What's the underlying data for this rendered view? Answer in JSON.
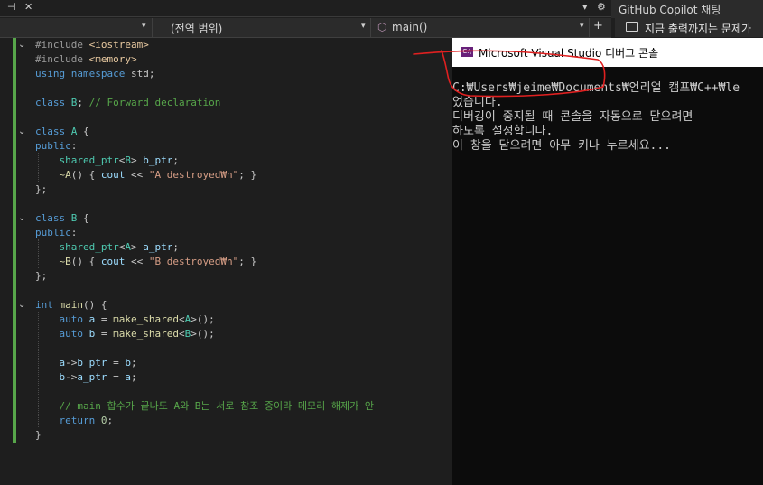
{
  "toolbar": {
    "pin_glyph": "⊣",
    "close_glyph": "✕",
    "dropdown_glyph": "▾",
    "gear_glyph": "⚙"
  },
  "navigation": {
    "project_value": "",
    "scope_label": "(전역 범위)",
    "member_label": "main()",
    "split_glyph": "+"
  },
  "copilot": {
    "panel_title": "GitHub Copilot 채팅",
    "prompt_text": "지금 출력까지는 문제가"
  },
  "editor": {
    "lines": [
      {
        "parts": [
          [
            "pp",
            "#include "
          ],
          [
            "inc",
            "<iostream>"
          ]
        ]
      },
      {
        "parts": [
          [
            "pp",
            "#include "
          ],
          [
            "inc",
            "<memory>"
          ]
        ]
      },
      {
        "parts": [
          [
            "kw",
            "using namespace "
          ],
          [
            "pl",
            "std;"
          ]
        ]
      },
      {
        "parts": []
      },
      {
        "parts": [
          [
            "kw",
            "class "
          ],
          [
            "ty",
            "B"
          ],
          [
            "pl",
            "; "
          ],
          [
            "cm",
            "// Forward declaration"
          ]
        ]
      },
      {
        "parts": []
      },
      {
        "parts": [
          [
            "kw",
            "class "
          ],
          [
            "ty",
            "A"
          ],
          [
            "pl",
            " {"
          ]
        ]
      },
      {
        "parts": [
          [
            "kw",
            "public"
          ],
          [
            "pl",
            ":"
          ]
        ]
      },
      {
        "parts": [
          [
            "pl",
            "    "
          ],
          [
            "ty",
            "shared_ptr"
          ],
          [
            "pl",
            "<"
          ],
          [
            "ty",
            "B"
          ],
          [
            "pl",
            "> "
          ],
          [
            "ptr",
            "b_ptr"
          ],
          [
            "pl",
            ";"
          ]
        ]
      },
      {
        "parts": [
          [
            "pl",
            "    "
          ],
          [
            "fn",
            "~A"
          ],
          [
            "pl",
            "() { "
          ],
          [
            "ptr",
            "cout"
          ],
          [
            "pl",
            " << "
          ],
          [
            "st",
            "\"A destroyed₩n\""
          ],
          [
            "pl",
            "; }"
          ]
        ]
      },
      {
        "parts": [
          [
            "pl",
            "};"
          ]
        ]
      },
      {
        "parts": []
      },
      {
        "parts": [
          [
            "kw",
            "class "
          ],
          [
            "ty",
            "B"
          ],
          [
            "pl",
            " {"
          ]
        ]
      },
      {
        "parts": [
          [
            "kw",
            "public"
          ],
          [
            "pl",
            ":"
          ]
        ]
      },
      {
        "parts": [
          [
            "pl",
            "    "
          ],
          [
            "ty",
            "shared_ptr"
          ],
          [
            "pl",
            "<"
          ],
          [
            "ty",
            "A"
          ],
          [
            "pl",
            "> "
          ],
          [
            "ptr",
            "a_ptr"
          ],
          [
            "pl",
            ";"
          ]
        ]
      },
      {
        "parts": [
          [
            "pl",
            "    "
          ],
          [
            "fn",
            "~B"
          ],
          [
            "pl",
            "() { "
          ],
          [
            "ptr",
            "cout"
          ],
          [
            "pl",
            " << "
          ],
          [
            "st",
            "\"B destroyed₩n\""
          ],
          [
            "pl",
            "; }"
          ]
        ]
      },
      {
        "parts": [
          [
            "pl",
            "};"
          ]
        ]
      },
      {
        "parts": []
      },
      {
        "parts": [
          [
            "kw",
            "int "
          ],
          [
            "fn",
            "main"
          ],
          [
            "pl",
            "() {"
          ]
        ]
      },
      {
        "parts": [
          [
            "pl",
            "    "
          ],
          [
            "kw",
            "auto "
          ],
          [
            "ptr",
            "a"
          ],
          [
            "pl",
            " = "
          ],
          [
            "fn",
            "make_shared"
          ],
          [
            "pl",
            "<"
          ],
          [
            "ty",
            "A"
          ],
          [
            "pl",
            ">();"
          ]
        ]
      },
      {
        "parts": [
          [
            "pl",
            "    "
          ],
          [
            "kw",
            "auto "
          ],
          [
            "ptr",
            "b"
          ],
          [
            "pl",
            " = "
          ],
          [
            "fn",
            "make_shared"
          ],
          [
            "pl",
            "<"
          ],
          [
            "ty",
            "B"
          ],
          [
            "pl",
            ">();"
          ]
        ]
      },
      {
        "parts": []
      },
      {
        "parts": [
          [
            "pl",
            "    "
          ],
          [
            "ptr",
            "a"
          ],
          [
            "pl",
            "->"
          ],
          [
            "ptr",
            "b_ptr"
          ],
          [
            "pl",
            " = "
          ],
          [
            "ptr",
            "b"
          ],
          [
            "pl",
            ";"
          ]
        ]
      },
      {
        "parts": [
          [
            "pl",
            "    "
          ],
          [
            "ptr",
            "b"
          ],
          [
            "pl",
            "->"
          ],
          [
            "ptr",
            "a_ptr"
          ],
          [
            "pl",
            " = "
          ],
          [
            "ptr",
            "a"
          ],
          [
            "pl",
            ";"
          ]
        ]
      },
      {
        "parts": []
      },
      {
        "parts": [
          [
            "pl",
            "    "
          ],
          [
            "cm",
            "// main 합수가 끝나도 A와 B는 서로 참조 중이라 메모리 해제가 안"
          ]
        ]
      },
      {
        "parts": [
          [
            "pl",
            "    "
          ],
          [
            "kw",
            "return "
          ],
          [
            "nm",
            "0"
          ],
          [
            "pl",
            ";"
          ]
        ]
      },
      {
        "parts": [
          [
            "pl",
            "}"
          ]
        ]
      }
    ]
  },
  "console": {
    "title": "Microsoft Visual Studio 디버그 콘솔",
    "icon_label": "C:\\",
    "output": [
      "C:₩Users₩jeime₩Documents₩언리얼 캠프₩C++₩le",
      "었습니다.",
      "디버깅이 중지될 때 콘솔을 자동으로 닫으려면",
      "하도록 설정합니다.",
      "이 창을 닫으려면 아무 키나 누르세요..."
    ]
  },
  "colors": {
    "editor_bg": "#1e1e1e",
    "console_bg": "#0c0c0c",
    "annotation_red": "#e02020"
  }
}
